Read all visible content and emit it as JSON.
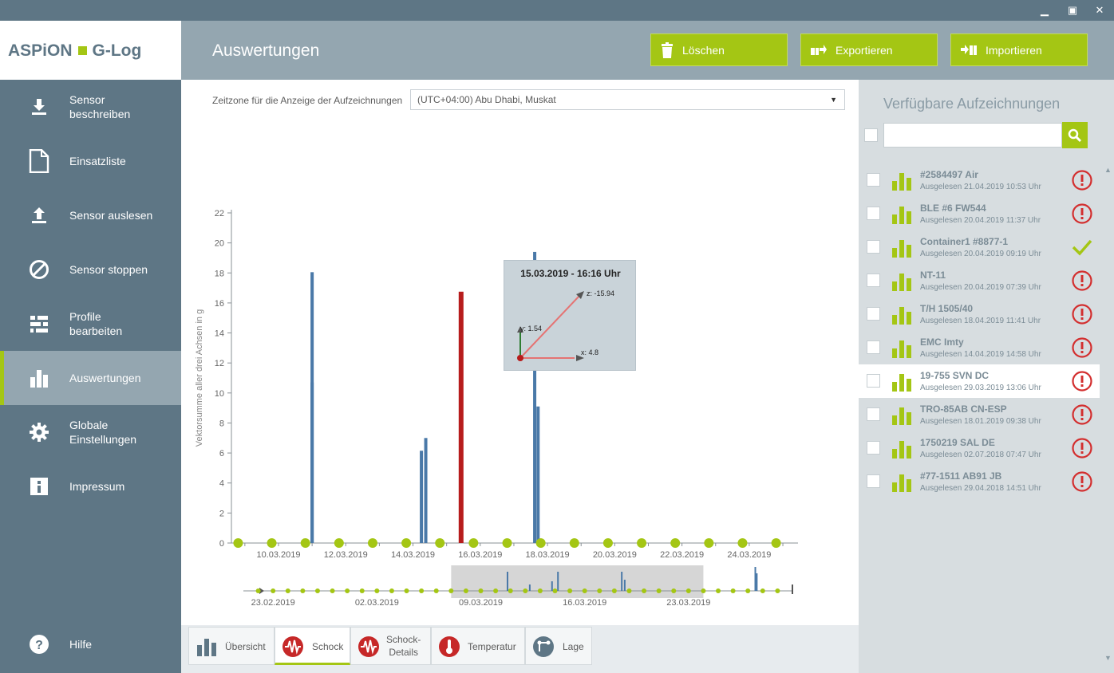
{
  "window": {
    "minimize": "▁",
    "maximize": "▣",
    "close": "✕"
  },
  "logo": {
    "part1": "ASPiON",
    "part2": "G-Log"
  },
  "header": {
    "title": "Auswertungen",
    "buttons": [
      {
        "label": "Löschen",
        "icon": "trash-icon"
      },
      {
        "label": "Exportieren",
        "icon": "export-icon"
      },
      {
        "label": "Importieren",
        "icon": "import-icon"
      }
    ]
  },
  "sidebar": {
    "items": [
      {
        "label": "Sensor\nbeschreiben",
        "icon": "download-icon"
      },
      {
        "label": "Einsatzliste",
        "icon": "document-icon"
      },
      {
        "label": "Sensor auslesen",
        "icon": "upload-icon"
      },
      {
        "label": "Sensor stoppen",
        "icon": "stop-icon"
      },
      {
        "label": "Profile\nbearbeiten",
        "icon": "sliders-icon"
      },
      {
        "label": "Auswertungen",
        "icon": "bar-chart-icon",
        "active": true
      },
      {
        "label": "Globale\nEinstellungen",
        "icon": "gear-icon"
      },
      {
        "label": "Impressum",
        "icon": "info-icon"
      }
    ],
    "help": {
      "label": "Hilfe",
      "icon": "help-icon"
    }
  },
  "timezone": {
    "label": "Zeitzone für die Anzeige der Aufzeichnungen",
    "value": "(UTC+04:00) Abu Dhabi, Muskat"
  },
  "chart_data": {
    "type": "bar",
    "ylabel": "Vektorsumme aller drei Achsen in g",
    "ylim": [
      0,
      22
    ],
    "yticks": [
      0,
      2,
      4,
      6,
      8,
      10,
      12,
      14,
      16,
      18,
      20,
      22
    ],
    "x_date_labels": [
      "10.03.2019",
      "12.03.2019",
      "14.03.2019",
      "16.03.2019",
      "18.03.2019",
      "20.03.2019",
      "22.03.2019",
      "24.03.2019"
    ],
    "x_range_days": [
      8.6,
      25.45
    ],
    "bars": [
      {
        "day": 11.0,
        "value": 18.05
      },
      {
        "day": 11.0,
        "value": 10.7
      },
      {
        "day": 14.25,
        "value": 6.15
      },
      {
        "day": 14.38,
        "value": 7.0
      },
      {
        "day": 15.43,
        "value": 16.75,
        "highlighted": true
      },
      {
        "day": 17.62,
        "value": 19.4
      },
      {
        "day": 17.72,
        "value": 9.1
      }
    ],
    "marker_days": [
      8.8,
      9.8,
      10.8,
      11.8,
      12.8,
      13.8,
      14.8,
      15.8,
      16.8,
      17.8,
      18.8,
      19.8,
      20.8,
      21.8,
      22.8,
      23.8,
      24.8
    ],
    "colors": {
      "bar": "#4a79a8",
      "highlight": "#b71c1c",
      "marker": "#a4c614",
      "axis": "#8a9196"
    },
    "tooltip": {
      "title": "15.03.2019 - 16:16 Uhr",
      "x_label": "x: 4.8",
      "y_label": "y: 1.54",
      "z_label": "z: -15.94"
    },
    "overview": {
      "date_labels": [
        "23.02.2019",
        "02.03.2019",
        "09.03.2019",
        "16.03.2019",
        "23.03.2019"
      ],
      "range": [
        23.0,
        60.0
      ],
      "label_days": [
        25,
        32,
        39,
        46,
        53
      ],
      "window": [
        37.0,
        54.0
      ],
      "spikes": [
        {
          "day": 40.8,
          "h": 24
        },
        {
          "day": 42.3,
          "h": 8
        },
        {
          "day": 43.8,
          "h": 12
        },
        {
          "day": 44.2,
          "h": 24
        },
        {
          "day": 48.5,
          "h": 24
        },
        {
          "day": 48.7,
          "h": 14
        },
        {
          "day": 57.5,
          "h": 30
        },
        {
          "day": 57.6,
          "h": 22
        }
      ]
    }
  },
  "tabs": [
    {
      "label": "Übersicht",
      "icon": "overview-bars-icon"
    },
    {
      "label": "Schock",
      "icon": "shock-icon",
      "active": true
    },
    {
      "label": "Schock-\nDetails",
      "icon": "shock-details-icon"
    },
    {
      "label": "Temperatur",
      "icon": "thermometer-icon"
    },
    {
      "label": "Lage",
      "icon": "position-icon"
    }
  ],
  "records_panel": {
    "title": "Verfügbare Aufzeichnungen",
    "search_placeholder": "",
    "records": [
      {
        "name": "#2584497 Air",
        "sub": "Ausgelesen 21.04.2019 10:53 Uhr",
        "status": "alert"
      },
      {
        "name": "BLE #6 FW544",
        "sub": "Ausgelesen 20.04.2019 11:37 Uhr",
        "status": "alert"
      },
      {
        "name": "Container1 #8877-1",
        "sub": "Ausgelesen 20.04.2019 09:19 Uhr",
        "status": "ok"
      },
      {
        "name": "NT-11",
        "sub": "Ausgelesen 20.04.2019 07:39 Uhr",
        "status": "alert"
      },
      {
        "name": "T/H 1505/40",
        "sub": "Ausgelesen 18.04.2019 11:41 Uhr",
        "status": "alert"
      },
      {
        "name": "EMC Imty",
        "sub": "Ausgelesen 14.04.2019 14:58 Uhr",
        "status": "alert"
      },
      {
        "name": "19-755 SVN DC",
        "sub": "Ausgelesen 29.03.2019 13:06 Uhr",
        "status": "alert",
        "selected": true
      },
      {
        "name": "TRO-85AB CN-ESP",
        "sub": "Ausgelesen 18.01.2019 09:38 Uhr",
        "status": "alert"
      },
      {
        "name": "1750219 SAL DE",
        "sub": "Ausgelesen 02.07.2018 07:47 Uhr",
        "status": "alert"
      },
      {
        "name": "#77-1511 AB91 JB",
        "sub": "Ausgelesen 29.04.2018 14:51 Uhr",
        "status": "alert"
      }
    ]
  }
}
